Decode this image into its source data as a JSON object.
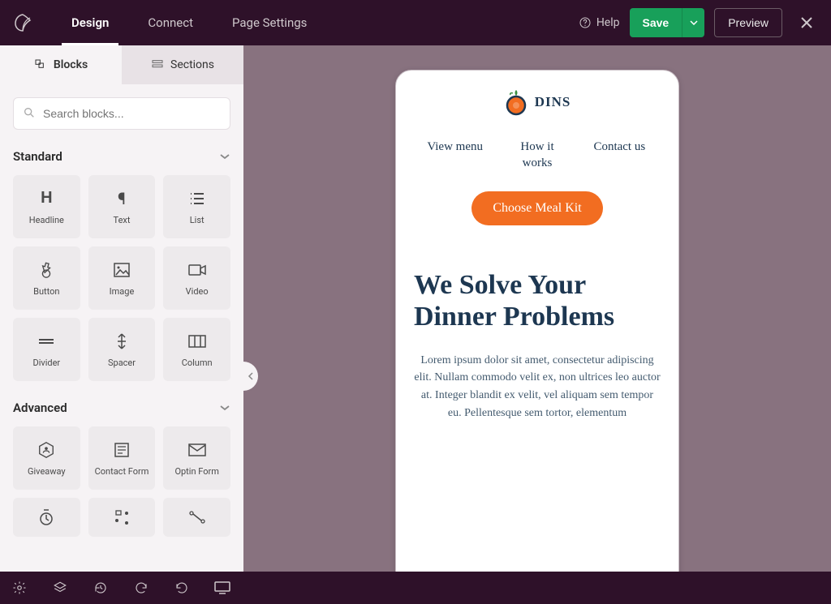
{
  "topbar": {
    "tabs": [
      "Design",
      "Connect",
      "Page Settings"
    ],
    "active_tab_index": 0,
    "help_label": "Help",
    "save_label": "Save",
    "preview_label": "Preview"
  },
  "sidebar": {
    "panel_tabs": [
      "Blocks",
      "Sections"
    ],
    "active_panel_index": 0,
    "search_placeholder": "Search blocks...",
    "sections": [
      {
        "title": "Standard",
        "blocks": [
          {
            "label": "Headline",
            "icon": "heading"
          },
          {
            "label": "Text",
            "icon": "paragraph"
          },
          {
            "label": "List",
            "icon": "list"
          },
          {
            "label": "Button",
            "icon": "button"
          },
          {
            "label": "Image",
            "icon": "image"
          },
          {
            "label": "Video",
            "icon": "video"
          },
          {
            "label": "Divider",
            "icon": "divider"
          },
          {
            "label": "Spacer",
            "icon": "spacer"
          },
          {
            "label": "Column",
            "icon": "column"
          }
        ]
      },
      {
        "title": "Advanced",
        "blocks": [
          {
            "label": "Giveaway",
            "icon": "giveaway"
          },
          {
            "label": "Contact Form",
            "icon": "contact-form"
          },
          {
            "label": "Optin Form",
            "icon": "optin-form"
          },
          {
            "label": "",
            "icon": "timer"
          },
          {
            "label": "",
            "icon": "share"
          },
          {
            "label": "",
            "icon": "network"
          }
        ]
      }
    ]
  },
  "preview": {
    "brand_name": "DINS",
    "nav": [
      "View menu",
      "How it works",
      "Contact us"
    ],
    "cta_label": "Choose Meal Kit",
    "headline": "We Solve Your Dinner Problems",
    "body_text": "Lorem ipsum dolor sit amet, consectetur adipiscing elit. Nullam commodo velit ex, non ultrices leo auctor at. Integer blandit ex velit, vel aliquam sem tempor eu. Pellentesque sem tortor, elementum"
  },
  "colors": {
    "topbar_bg": "#2e1129",
    "canvas_bg": "#88727f",
    "sidebar_bg": "#f6f3f5",
    "accent_green": "#18a05a",
    "cta_orange": "#f26d21",
    "site_text": "#1d3751"
  }
}
